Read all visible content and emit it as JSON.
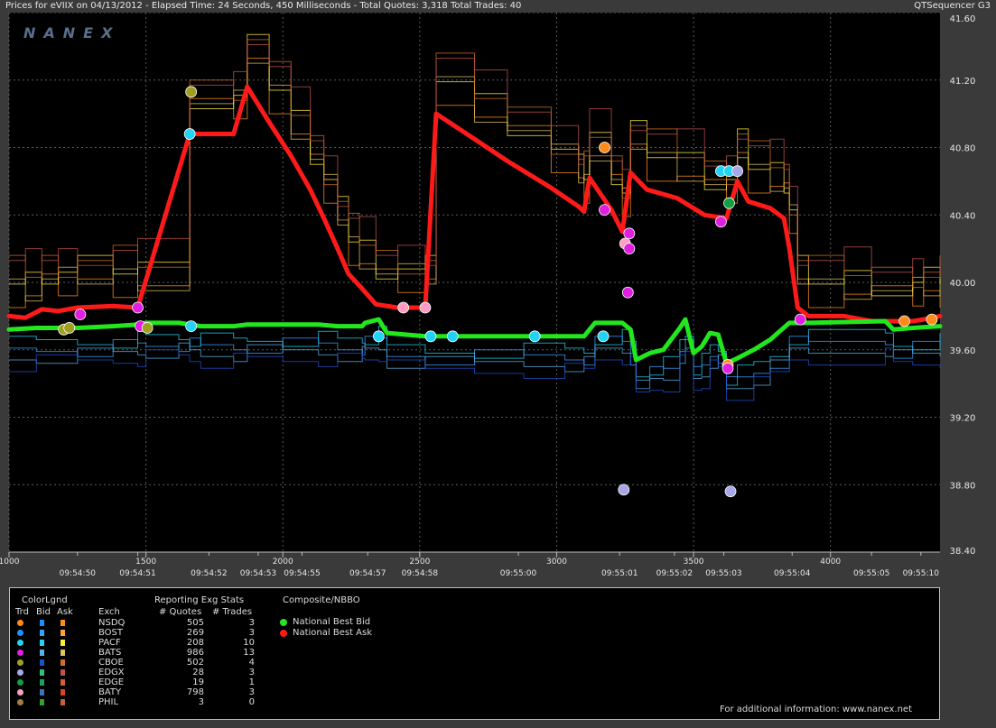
{
  "header": {
    "title": "Prices for  eVIIX  on  04/13/2012  -  Elapsed Time: 24 Seconds, 450 Milliseconds  -  Total Quotes: 3,318  Total Trades: 40",
    "app": "QTSequencer G3"
  },
  "watermark": "NANEX",
  "chart_data": {
    "type": "line",
    "y_ticks": [
      "41.60",
      "41.20",
      "40.80",
      "40.40",
      "40.00",
      "39.60",
      "39.20",
      "38.80",
      "38.40"
    ],
    "ylim": [
      38.4,
      41.6
    ],
    "xlim": [
      1000,
      4400
    ],
    "x_seq_ticks": [
      {
        "v": 1000,
        "label": "1000"
      },
      {
        "v": 1500,
        "label": "1500"
      },
      {
        "v": 2000,
        "label": "2000"
      },
      {
        "v": 2500,
        "label": "2500"
      },
      {
        "v": 3000,
        "label": "3000"
      },
      {
        "v": 3500,
        "label": "3500"
      },
      {
        "v": 4000,
        "label": "4000"
      }
    ],
    "x_time_ticks": [
      {
        "v": 1250,
        "label": "09:54:50"
      },
      {
        "v": 1470,
        "label": "09:54:51"
      },
      {
        "v": 1730,
        "label": "09:54:52"
      },
      {
        "v": 1910,
        "label": "09:54:53"
      },
      {
        "v": 2070,
        "label": "09:54:55"
      },
      {
        "v": 2310,
        "label": "09:54:57"
      },
      {
        "v": 2500,
        "label": "09:54:58"
      },
      {
        "v": 2860,
        "label": "09:55:00"
      },
      {
        "v": 3230,
        "label": "09:55:01"
      },
      {
        "v": 3430,
        "label": "09:55:02"
      },
      {
        "v": 3610,
        "label": "09:55:03"
      },
      {
        "v": 3860,
        "label": "09:55:04"
      },
      {
        "v": 4150,
        "label": "09:55:05"
      },
      {
        "v": 4330,
        "label": "09:55:10"
      }
    ],
    "series": [
      {
        "name": "National Best Ask",
        "color": "#ff1a1a",
        "points": [
          [
            1000,
            39.8
          ],
          [
            1060,
            39.79
          ],
          [
            1120,
            39.84
          ],
          [
            1180,
            39.83
          ],
          [
            1250,
            39.85
          ],
          [
            1380,
            39.86
          ],
          [
            1470,
            39.85
          ],
          [
            1660,
            40.88
          ],
          [
            1820,
            40.88
          ],
          [
            1870,
            41.16
          ],
          [
            1950,
            40.95
          ],
          [
            2030,
            40.75
          ],
          [
            2100,
            40.55
          ],
          [
            2150,
            40.38
          ],
          [
            2200,
            40.2
          ],
          [
            2240,
            40.05
          ],
          [
            2280,
            39.98
          ],
          [
            2340,
            39.87
          ],
          [
            2420,
            39.85
          ],
          [
            2520,
            39.85
          ],
          [
            2560,
            41.0
          ],
          [
            2700,
            40.85
          ],
          [
            2820,
            40.72
          ],
          [
            2980,
            40.56
          ],
          [
            3080,
            40.45
          ],
          [
            3100,
            40.42
          ],
          [
            3120,
            40.62
          ],
          [
            3200,
            40.43
          ],
          [
            3240,
            40.3
          ],
          [
            3270,
            40.65
          ],
          [
            3330,
            40.55
          ],
          [
            3440,
            40.5
          ],
          [
            3540,
            40.4
          ],
          [
            3620,
            40.38
          ],
          [
            3660,
            40.6
          ],
          [
            3700,
            40.48
          ],
          [
            3780,
            40.44
          ],
          [
            3830,
            40.38
          ],
          [
            3850,
            40.2
          ],
          [
            3880,
            39.85
          ],
          [
            3920,
            39.8
          ],
          [
            4050,
            39.8
          ],
          [
            4150,
            39.77
          ],
          [
            4300,
            39.77
          ],
          [
            4340,
            39.78
          ],
          [
            4400,
            39.8
          ]
        ]
      },
      {
        "name": "National Best Bid",
        "color": "#22e61e",
        "points": [
          [
            1000,
            39.72
          ],
          [
            1100,
            39.73
          ],
          [
            1250,
            39.73
          ],
          [
            1380,
            39.74
          ],
          [
            1470,
            39.75
          ],
          [
            1500,
            39.76
          ],
          [
            1620,
            39.76
          ],
          [
            1660,
            39.75
          ],
          [
            1700,
            39.74
          ],
          [
            1820,
            39.74
          ],
          [
            1870,
            39.75
          ],
          [
            2000,
            39.75
          ],
          [
            2130,
            39.75
          ],
          [
            2200,
            39.74
          ],
          [
            2290,
            39.74
          ],
          [
            2300,
            39.76
          ],
          [
            2350,
            39.78
          ],
          [
            2380,
            39.7
          ],
          [
            2520,
            39.68
          ],
          [
            2700,
            39.68
          ],
          [
            2880,
            39.68
          ],
          [
            3030,
            39.68
          ],
          [
            3100,
            39.68
          ],
          [
            3140,
            39.76
          ],
          [
            3240,
            39.76
          ],
          [
            3270,
            39.72
          ],
          [
            3290,
            39.54
          ],
          [
            3340,
            39.58
          ],
          [
            3390,
            39.6
          ],
          [
            3450,
            39.73
          ],
          [
            3470,
            39.78
          ],
          [
            3500,
            39.58
          ],
          [
            3530,
            39.62
          ],
          [
            3560,
            39.7
          ],
          [
            3590,
            39.69
          ],
          [
            3620,
            39.52
          ],
          [
            3660,
            39.55
          ],
          [
            3720,
            39.6
          ],
          [
            3780,
            39.66
          ],
          [
            3850,
            39.76
          ],
          [
            3920,
            39.76
          ],
          [
            4200,
            39.77
          ],
          [
            4230,
            39.72
          ],
          [
            4300,
            39.73
          ],
          [
            4400,
            39.74
          ]
        ]
      }
    ],
    "trades": [
      {
        "x": 1200,
        "y": 39.72,
        "exch": "CBOE"
      },
      {
        "x": 1220,
        "y": 39.73,
        "exch": "CBOE"
      },
      {
        "x": 1260,
        "y": 39.81,
        "exch": "BATS"
      },
      {
        "x": 1470,
        "y": 39.85,
        "exch": "BATS"
      },
      {
        "x": 1480,
        "y": 39.74,
        "exch": "BATS"
      },
      {
        "x": 1505,
        "y": 39.73,
        "exch": "CBOE"
      },
      {
        "x": 1660,
        "y": 40.88,
        "exch": "PACF"
      },
      {
        "x": 1665,
        "y": 41.13,
        "exch": "CBOE"
      },
      {
        "x": 1665,
        "y": 39.74,
        "exch": "PACF"
      },
      {
        "x": 2350,
        "y": 39.68,
        "exch": "PACF"
      },
      {
        "x": 2440,
        "y": 39.85,
        "exch": "BATY"
      },
      {
        "x": 2520,
        "y": 39.85,
        "exch": "BATY"
      },
      {
        "x": 2540,
        "y": 39.68,
        "exch": "PACF"
      },
      {
        "x": 2620,
        "y": 39.68,
        "exch": "PACF"
      },
      {
        "x": 2920,
        "y": 39.68,
        "exch": "PACF"
      },
      {
        "x": 3170,
        "y": 39.68,
        "exch": "PACF"
      },
      {
        "x": 3175,
        "y": 40.43,
        "exch": "BATS"
      },
      {
        "x": 3175,
        "y": 40.8,
        "exch": "NSDQ"
      },
      {
        "x": 3250,
        "y": 40.23,
        "exch": "BATY"
      },
      {
        "x": 3265,
        "y": 40.29,
        "exch": "BATS"
      },
      {
        "x": 3265,
        "y": 40.2,
        "exch": "BATS"
      },
      {
        "x": 3260,
        "y": 39.94,
        "exch": "BATS"
      },
      {
        "x": 3245,
        "y": 38.77,
        "exch": "EDGX"
      },
      {
        "x": 3600,
        "y": 40.66,
        "exch": "PACF"
      },
      {
        "x": 3630,
        "y": 40.66,
        "exch": "PACF"
      },
      {
        "x": 3660,
        "y": 40.66,
        "exch": "EDGX"
      },
      {
        "x": 3630,
        "y": 40.47,
        "exch": "EDGE"
      },
      {
        "x": 3600,
        "y": 40.36,
        "exch": "BATS"
      },
      {
        "x": 3625,
        "y": 39.51,
        "exch": "NSDQ"
      },
      {
        "x": 3625,
        "y": 39.49,
        "exch": "BATS"
      },
      {
        "x": 3635,
        "y": 38.76,
        "exch": "EDGX"
      },
      {
        "x": 3890,
        "y": 39.78,
        "exch": "BATS"
      },
      {
        "x": 4270,
        "y": 39.77,
        "exch": "NSDQ"
      },
      {
        "x": 4370,
        "y": 39.78,
        "exch": "NSDQ"
      }
    ],
    "grid": true
  },
  "legend": {
    "col_headers": {
      "color_legend": "ColorLgnd",
      "trd": "Trd",
      "bid": "Bid",
      "ask": "Ask",
      "exch": "Exch",
      "stats_title": "Reporting Exg Stats",
      "quotes": "# Quotes",
      "trades": "# Trades",
      "composite": "Composite/NBBO"
    },
    "rows": [
      {
        "exch": "NSDQ",
        "quotes": "505",
        "trades": "3",
        "trd": "#ff8c1a",
        "bid": "#1e8cff",
        "ask": "#ff8c1a"
      },
      {
        "exch": "BOST",
        "quotes": "269",
        "trades": "3",
        "trd": "#1e90ff",
        "bid": "#3aa0ff",
        "ask": "#ffa040"
      },
      {
        "exch": "PACF",
        "quotes": "208",
        "trades": "10",
        "trd": "#22d3f5",
        "bid": "#22d3f5",
        "ask": "#ffeb3b"
      },
      {
        "exch": "BATS",
        "quotes": "986",
        "trades": "13",
        "trd": "#e020e0",
        "bid": "#5ab0e8",
        "ask": "#e0c060"
      },
      {
        "exch": "CBOE",
        "quotes": "502",
        "trades": "4",
        "trd": "#a0a020",
        "bid": "#2050d0",
        "ask": "#d07020"
      },
      {
        "exch": "EDGX",
        "quotes": "28",
        "trades": "3",
        "trd": "#a8a8e8",
        "bid": "#30c080",
        "ask": "#c05050"
      },
      {
        "exch": "EDGE",
        "quotes": "19",
        "trades": "1",
        "trd": "#10a040",
        "bid": "#20a060",
        "ask": "#d06030"
      },
      {
        "exch": "BATY",
        "quotes": "798",
        "trades": "3",
        "trd": "#ff9ec0",
        "bid": "#4070c0",
        "ask": "#e04020"
      },
      {
        "exch": "PHIL",
        "quotes": "3",
        "trades": "0",
        "trd": "#a08040",
        "bid": "#30a030",
        "ask": "#c06040"
      }
    ],
    "composite": [
      {
        "label": "National Best Bid",
        "color": "#22e61e"
      },
      {
        "label": "National Best Ask",
        "color": "#ff1a1a"
      }
    ],
    "footer": "For additional information: www.nanex.net"
  }
}
